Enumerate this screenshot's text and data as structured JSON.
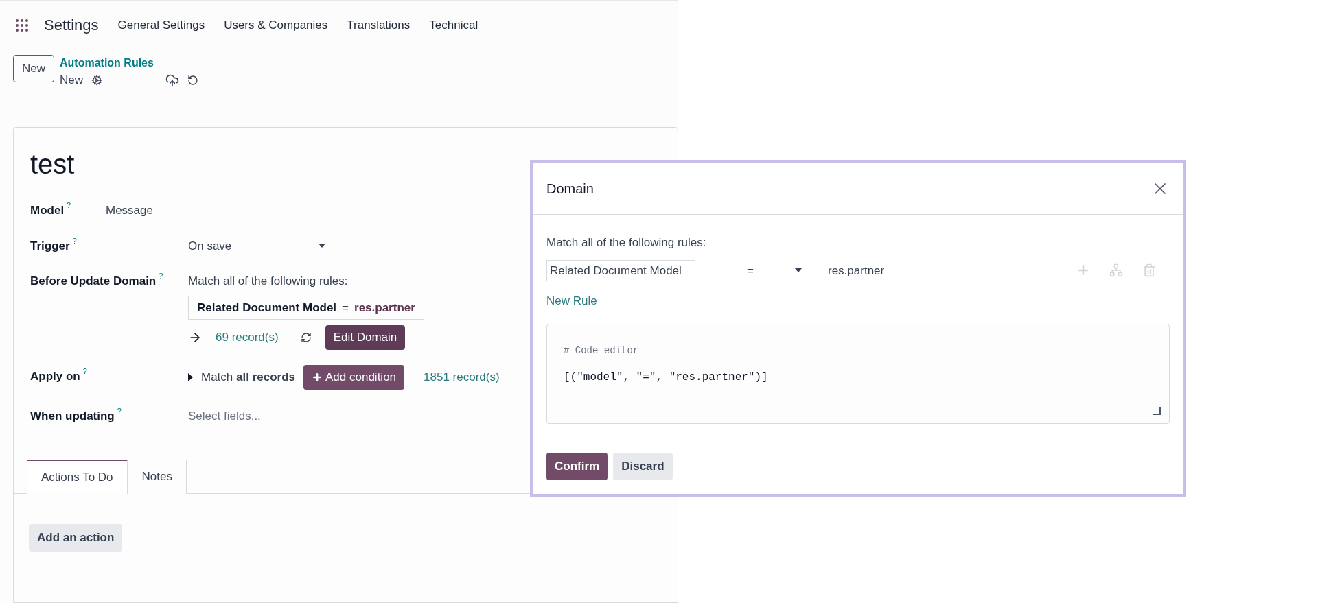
{
  "navbar": {
    "app_title": "Settings",
    "menu": [
      "General Settings",
      "Users & Companies",
      "Translations",
      "Technical"
    ]
  },
  "control_panel": {
    "new_button": "New",
    "breadcrumb": "Automation Rules",
    "record_name": "New"
  },
  "form": {
    "title": "test",
    "model": {
      "label": "Model",
      "help": "?",
      "value": "Message"
    },
    "trigger": {
      "label": "Trigger",
      "help": "?",
      "value": "On save"
    },
    "before_update_domain": {
      "label": "Before Update Domain",
      "help": "?",
      "intro": "Match all of the following rules:",
      "rule_field": "Related Document Model",
      "rule_operator": "=",
      "rule_value": "res.partner",
      "records": "69 record(s)",
      "edit_button": "Edit Domain"
    },
    "apply_on": {
      "label": "Apply on",
      "help": "?",
      "match": "Match **all records**",
      "add_button": "Add condition",
      "records": "1851 record(s)"
    },
    "when_updating": {
      "label": "When updating",
      "help": "?",
      "placeholder": "Select fields..."
    },
    "tabs": [
      {
        "label": "Actions To Do",
        "selected": true
      },
      {
        "label": "Notes",
        "selected": false
      }
    ],
    "add_action_button": "Add an action"
  },
  "dialog": {
    "title": "Domain",
    "intro": "Match all of the following rules:",
    "rule": {
      "field": "Related Document Model",
      "operator": "=",
      "value": "res.partner"
    },
    "new_rule": "New Rule",
    "code_comment": "# Code editor",
    "code": "[(\"model\", \"=\", \"res.partner\")]",
    "buttons": [
      {
        "label": "Confirm",
        "kind": "primary"
      },
      {
        "label": "Discard",
        "kind": "secondary"
      }
    ]
  }
}
